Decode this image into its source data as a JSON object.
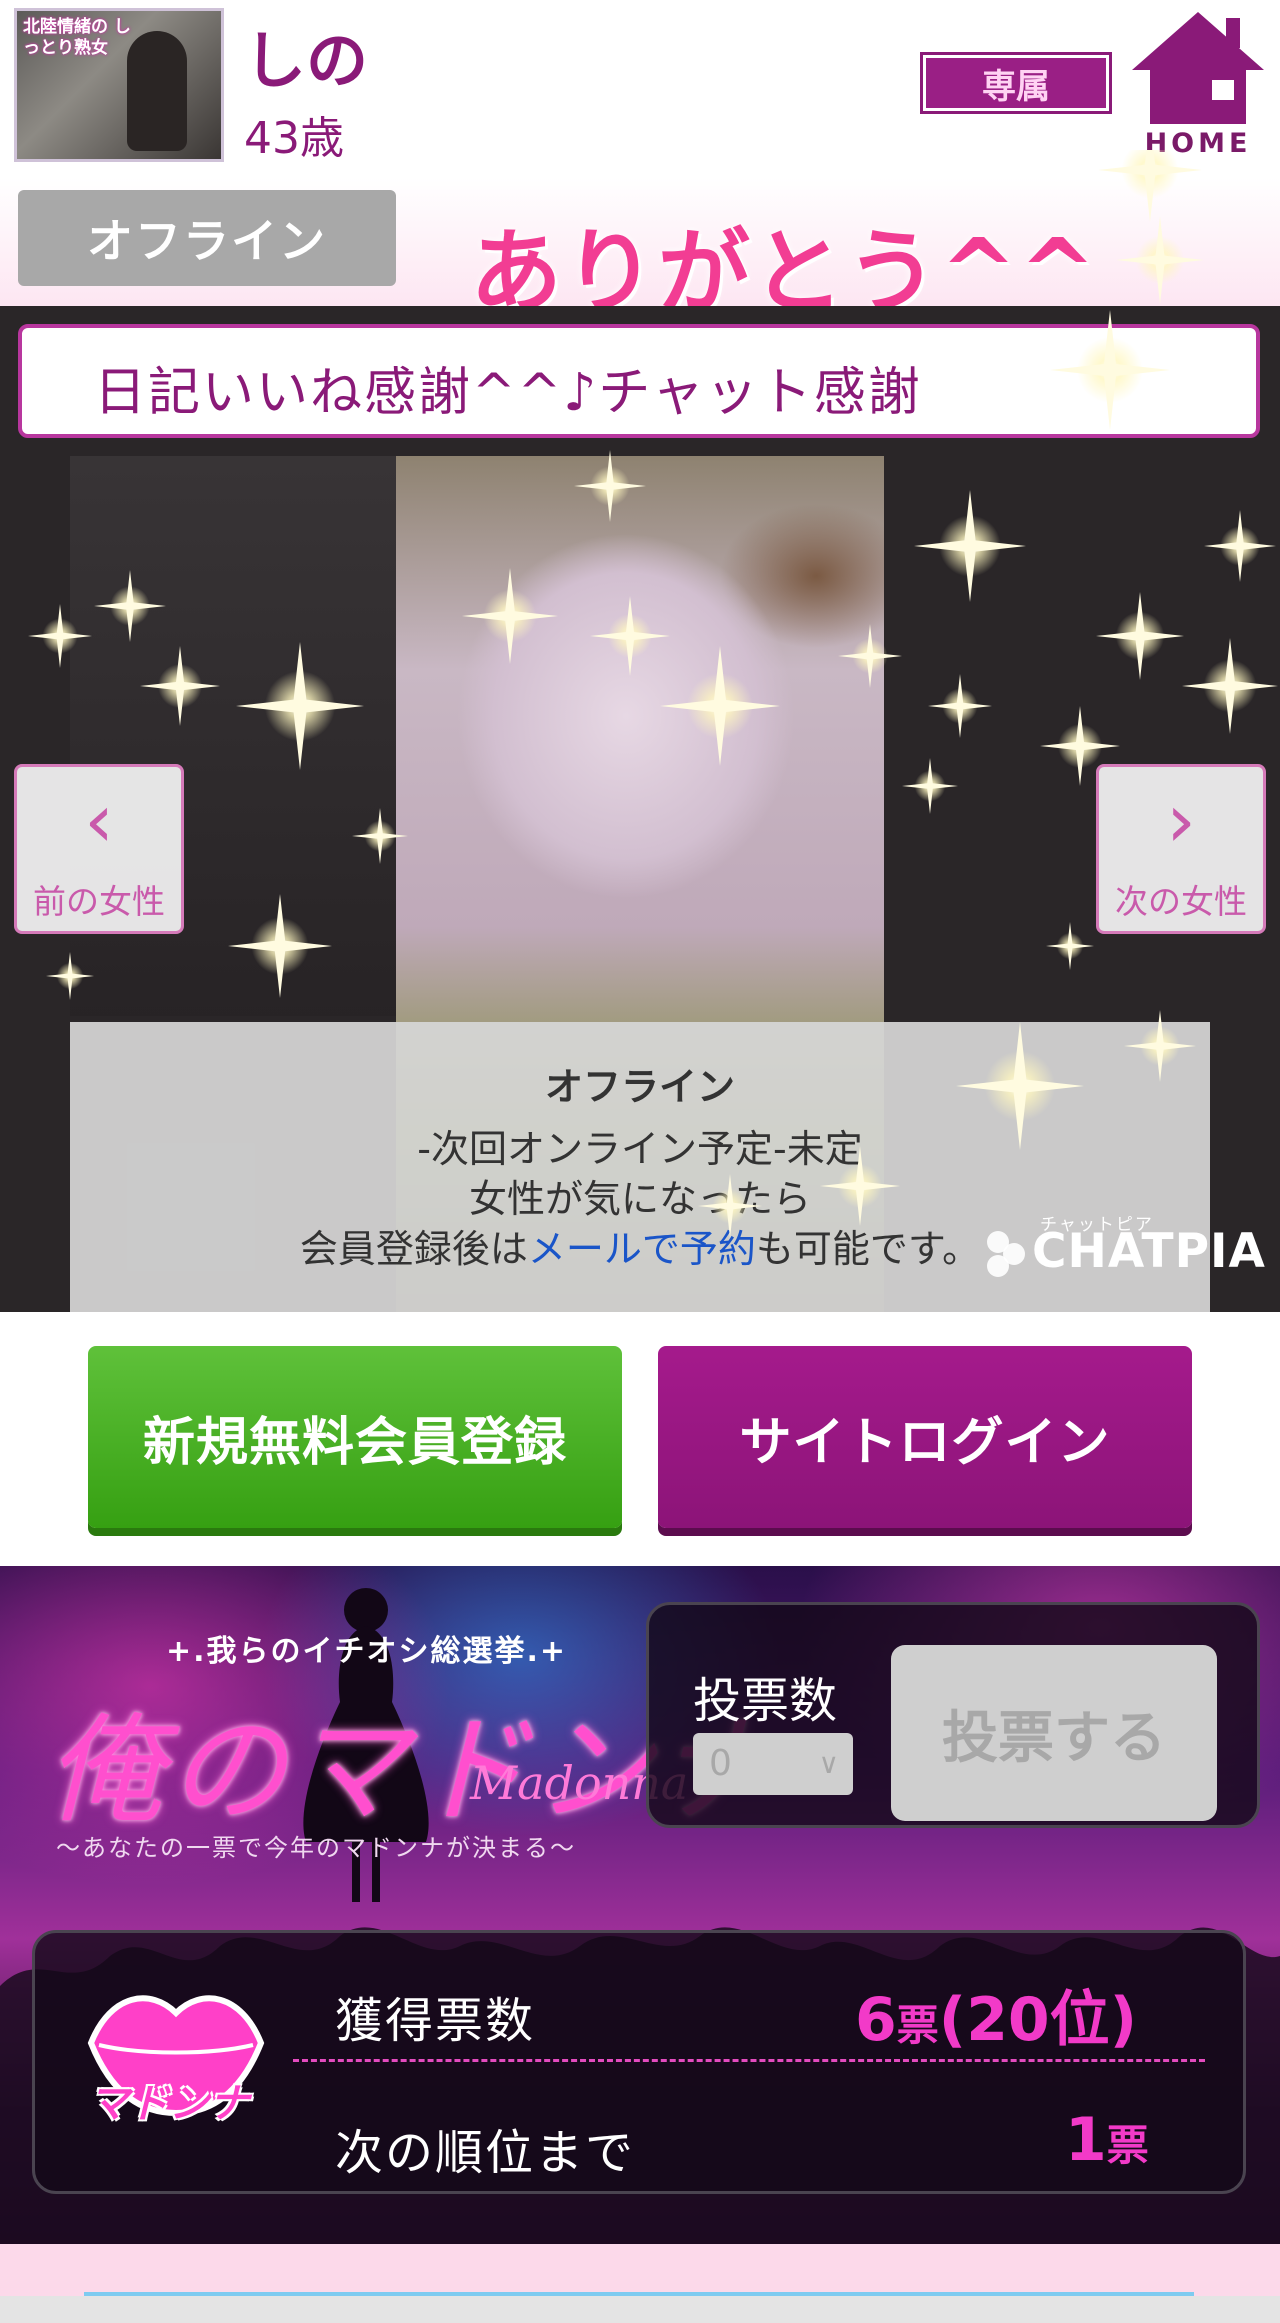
{
  "header": {
    "name": "しの",
    "age": "43歳",
    "avatar_caption": "北陸情緒の しっとり熟女",
    "exclusive_label": "専属",
    "home_label": "HOME"
  },
  "status": {
    "online_badge": "オフライン",
    "thanks_message": "ありがとう^^_"
  },
  "stage": {
    "tagline": "日記いいね感謝^^♪チャット感謝",
    "prev_label": "前の女性",
    "next_label": "次の女性",
    "offline_panel": {
      "title": "オフライン",
      "line1": "-次回オンライン予定-未定",
      "line2": "女性が気になったら",
      "line3_before": "会員登録後は",
      "line3_link": "メールで予約",
      "line3_after": "も可能です。"
    },
    "watermark_small": "チャットピア",
    "watermark": "CHATPIA"
  },
  "actions": {
    "register_label": "新規無料会員登録",
    "login_label": "サイトログイン"
  },
  "madonna": {
    "catchphrase": "+.我らのイチオシ総選挙.+",
    "title": "俺のマドンナ",
    "subtitle": "Madonna",
    "tagline": "〜あなたの一票で今年のマドンナが決まる〜",
    "vote_count_label": "投票数",
    "vote_select_value": "0",
    "vote_button_label": "投票する",
    "badge_label": "マドンナ",
    "votes_label": "獲得票数",
    "votes_number": "6",
    "votes_unit": "票",
    "votes_rank": "(20位)",
    "next_rank_label": "次の順位まで",
    "next_rank_number": "1",
    "next_rank_unit": "票"
  },
  "colors": {
    "brand_purple": "#8a1a78",
    "accent_pink": "#f23d93",
    "register_green": "#3fa71a",
    "login_purple": "#9a1a84",
    "offline_gray": "#a8a8a8"
  }
}
